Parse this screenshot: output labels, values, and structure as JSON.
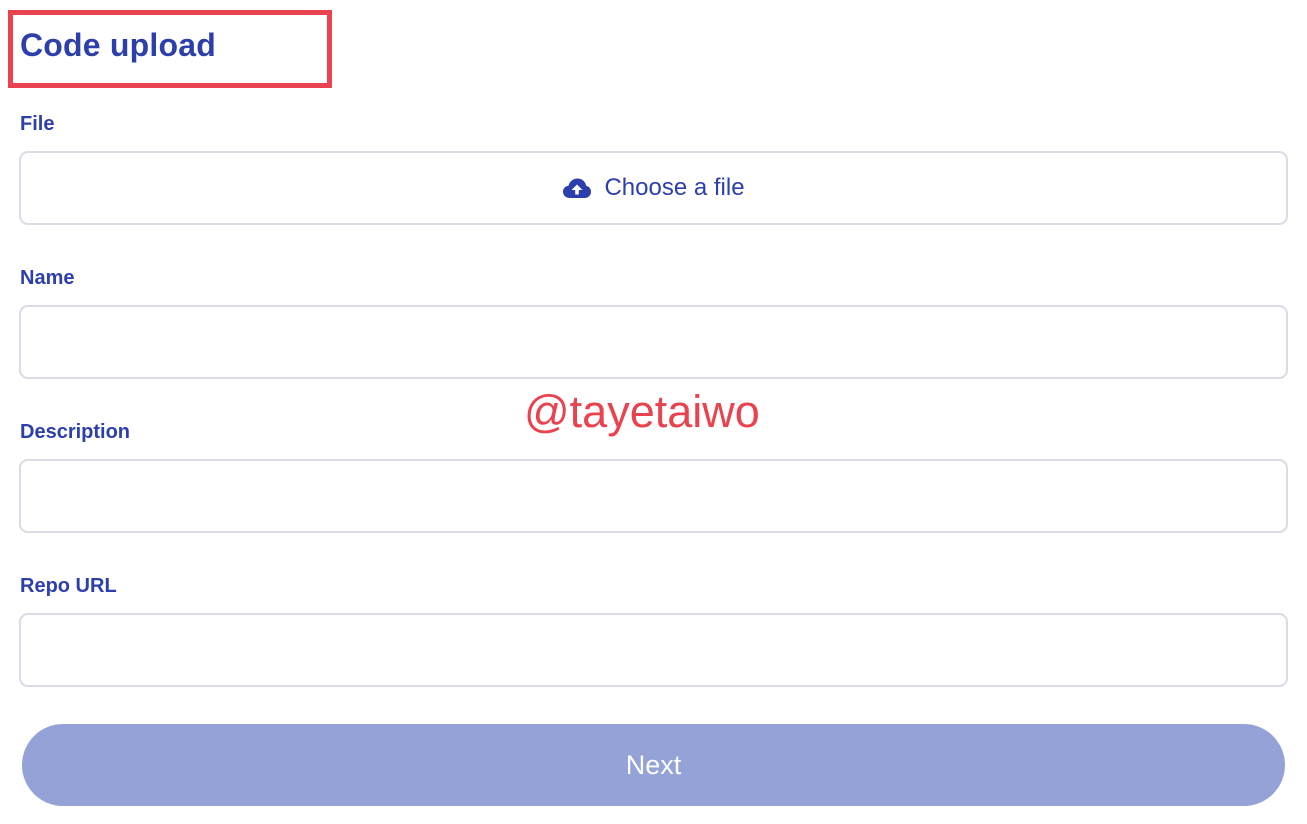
{
  "form": {
    "title": "Code upload",
    "file": {
      "label": "File",
      "button_text": "Choose a file",
      "icon": "cloud-upload-icon"
    },
    "name": {
      "label": "Name",
      "value": "",
      "placeholder": ""
    },
    "description": {
      "label": "Description",
      "value": "",
      "placeholder": ""
    },
    "repo_url": {
      "label": "Repo URL",
      "value": "",
      "placeholder": ""
    },
    "next_label": "Next"
  },
  "watermark": "@tayetaiwo",
  "colors": {
    "primary": "#2d3faa",
    "highlight": "#e8434e",
    "button_disabled": "#94a2d7",
    "field_border": "#d9dbe6"
  }
}
